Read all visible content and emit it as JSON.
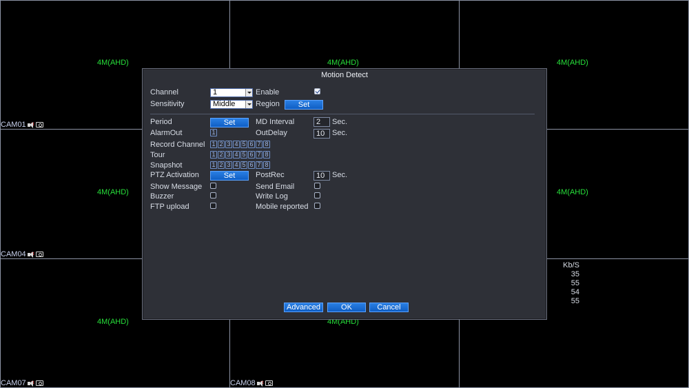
{
  "cameras": [
    {
      "resolution": "4M(AHD)",
      "label": "CAM01"
    },
    {
      "resolution": "4M(AHD)",
      "label": ""
    },
    {
      "resolution": "4M(AHD)",
      "label": ""
    },
    {
      "resolution": "4M(AHD)",
      "label": "CAM04"
    },
    {
      "resolution": "4M(AHD)",
      "label": ""
    },
    {
      "resolution": "4M(AHD)",
      "label": ""
    },
    {
      "resolution": "4M(AHD)",
      "label": "CAM07"
    },
    {
      "resolution": "4M(AHD)",
      "label": "CAM08"
    }
  ],
  "bitrate": {
    "header": "Kb/S",
    "values": [
      "35",
      "55",
      "54",
      "55"
    ]
  },
  "dialog": {
    "title": "Motion Detect",
    "channel": {
      "label": "Channel",
      "value": "1"
    },
    "enable": {
      "label": "Enable",
      "checked": true
    },
    "sensitivity": {
      "label": "Sensitivity",
      "value": "Middle"
    },
    "region": {
      "label": "Region",
      "button": "Set"
    },
    "period": {
      "label": "Period",
      "button": "Set"
    },
    "md_interval": {
      "label": "MD Interval",
      "value": "2",
      "unit": "Sec."
    },
    "alarm_out": {
      "label": "AlarmOut",
      "boxes": [
        "1"
      ]
    },
    "out_delay": {
      "label": "OutDelay",
      "value": "10",
      "unit": "Sec."
    },
    "record_channel": {
      "label": "Record Channel",
      "boxes": [
        "1",
        "2",
        "3",
        "4",
        "5",
        "6",
        "7",
        "8"
      ]
    },
    "tour": {
      "label": "Tour",
      "boxes": [
        "1",
        "2",
        "3",
        "4",
        "5",
        "6",
        "7",
        "8"
      ]
    },
    "snapshot": {
      "label": "Snapshot",
      "boxes": [
        "1",
        "2",
        "3",
        "4",
        "5",
        "6",
        "7",
        "8"
      ]
    },
    "ptz": {
      "label": "PTZ Activation",
      "button": "Set"
    },
    "post_rec": {
      "label": "PostRec",
      "value": "10",
      "unit": "Sec."
    },
    "show_message": {
      "label": "Show Message",
      "checked": false
    },
    "send_email": {
      "label": "Send Email",
      "checked": false
    },
    "buzzer": {
      "label": "Buzzer",
      "checked": false
    },
    "write_log": {
      "label": "Write Log",
      "checked": false
    },
    "ftp_upload": {
      "label": "FTP upload",
      "checked": false
    },
    "mobile_reported": {
      "label": "Mobile reported",
      "checked": false
    },
    "buttons": {
      "advanced": "Advanced",
      "ok": "OK",
      "cancel": "Cancel"
    }
  },
  "colors": {
    "resolution_text": "#27e03a",
    "button": "#1469d6",
    "dialog_bg": "#2e3037"
  }
}
